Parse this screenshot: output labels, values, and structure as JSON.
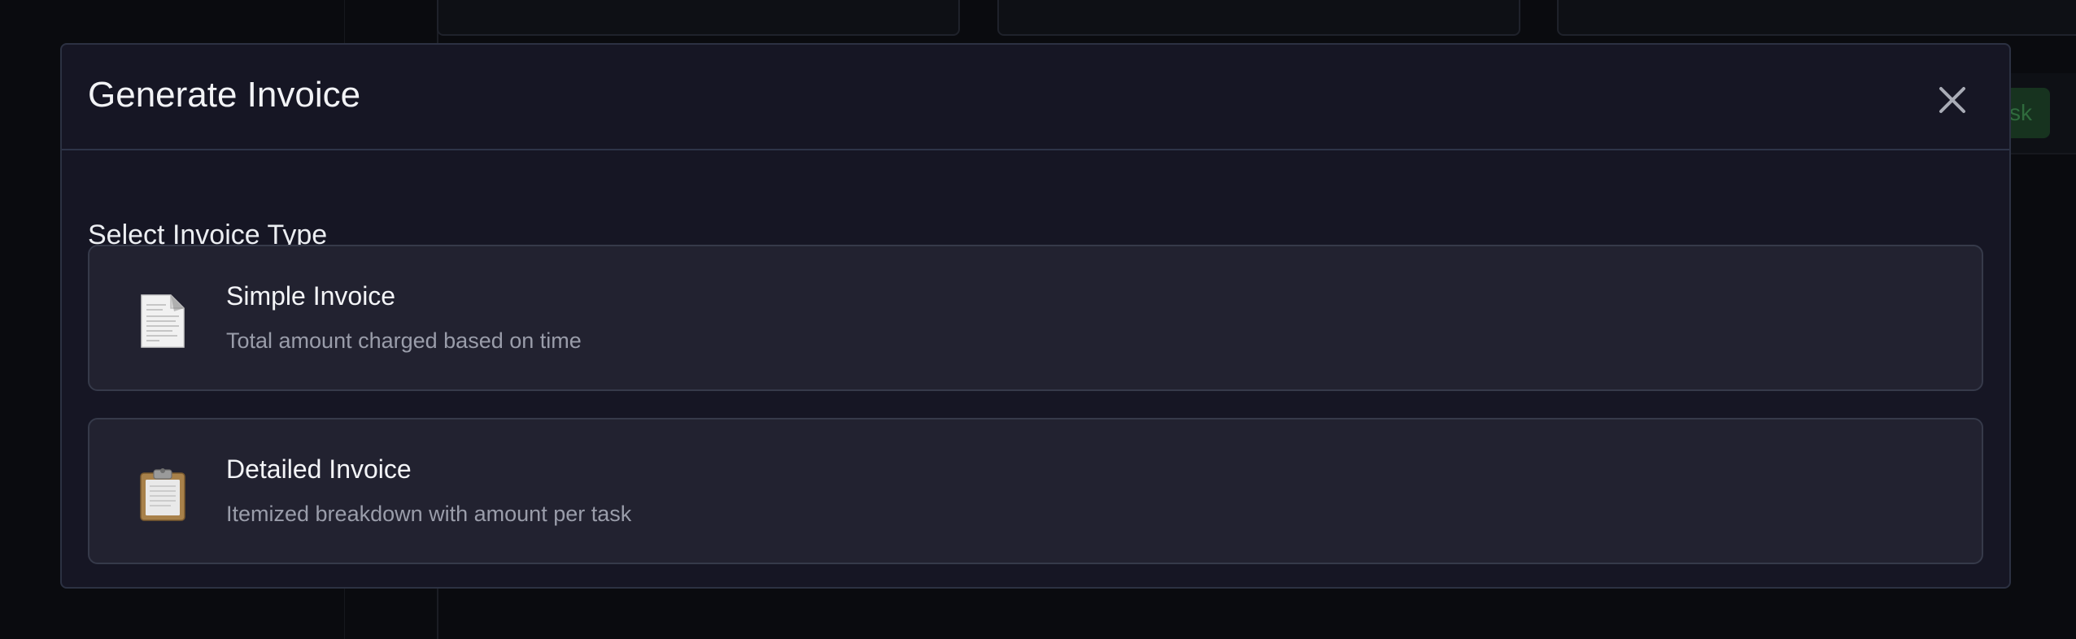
{
  "modal": {
    "title": "Generate Invoice",
    "section_title": "Select Invoice Type",
    "options": [
      {
        "title": "Simple Invoice",
        "description": "Total amount charged based on time",
        "icon": "document-icon"
      },
      {
        "title": "Detailed Invoice",
        "description": "Itemized breakdown with amount per task",
        "icon": "clipboard-icon"
      }
    ],
    "close_icon": "close-icon"
  },
  "background": {
    "task_button_label": "sk"
  },
  "colors": {
    "modal_bg": "#161624",
    "card_bg": "#222230",
    "card_border": "#363a4a",
    "text_primary": "#f2f3f6",
    "text_secondary": "#9a9daa",
    "backdrop": "#0a0b0f",
    "accent_green": "#17331f"
  }
}
